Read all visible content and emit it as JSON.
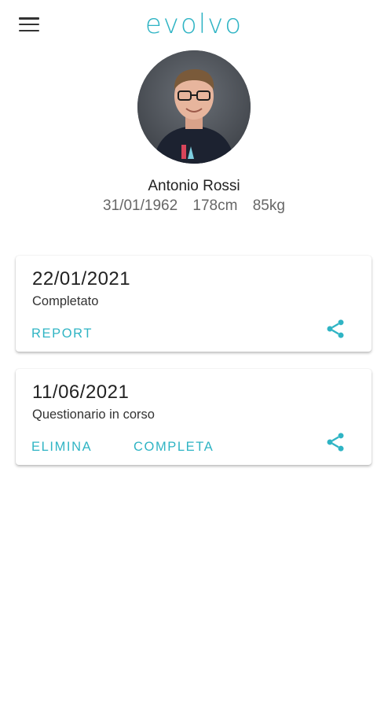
{
  "app": {
    "logo_text": "evolvo",
    "accent_color": "#2fb4c4"
  },
  "header": {
    "menu_icon": "hamburger-menu-icon"
  },
  "profile": {
    "name": "Antonio Rossi",
    "birth_date": "31/01/1962",
    "height": "178cm",
    "weight": "85kg",
    "avatar_icon": "profile-photo"
  },
  "cards": [
    {
      "date": "22/01/2021",
      "status": "Completato",
      "actions": [
        "REPORT"
      ],
      "share_icon": "share-icon"
    },
    {
      "date": "11/06/2021",
      "status": "Questionario in corso",
      "actions": [
        "ELIMINA",
        "COMPLETA"
      ],
      "share_icon": "share-icon"
    }
  ]
}
